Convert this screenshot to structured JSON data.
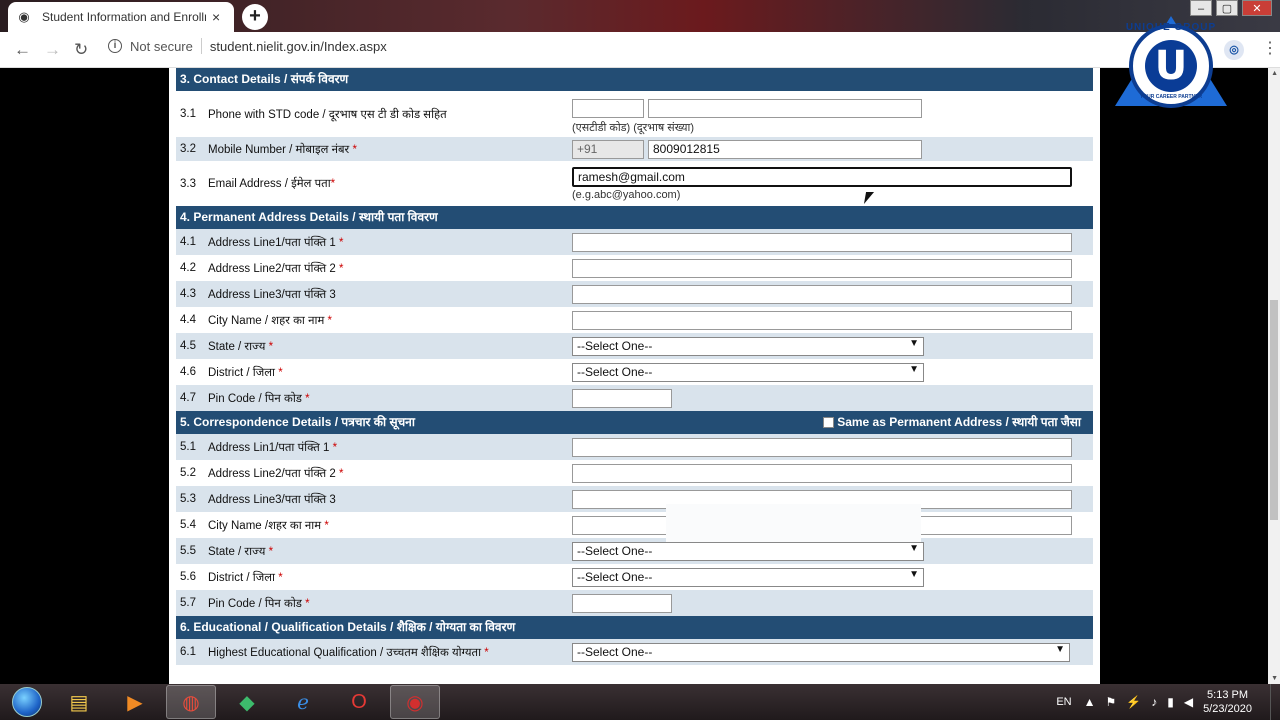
{
  "browser": {
    "tab_title": "Student Information and Enrollm",
    "security_label": "Not secure",
    "url": "student.nielit.gov.in/Index.aspx",
    "new_tab_symbol": "+",
    "tab_close_symbol": "×",
    "window_controls": [
      "‒",
      "▢",
      "✕"
    ]
  },
  "logo": {
    "top_text": "UNIQUE GROUP",
    "letter": "U",
    "bottom_text": "YOUR CAREER PARTNER"
  },
  "form": {
    "sections": {
      "contact": "3. Contact Details / संपर्क विवरण",
      "permanent": "4. Permanent Address Details / स्थायी पता विवरण",
      "correspondence": "5. Correspondence Details / पत्रचार की सूचना",
      "same_as_label": "Same as Permanent Address / स्थायी पता जैसा",
      "education": "6. Educational / Qualification Details / शैक्षिक / योग्यता का विवरण"
    },
    "contact": {
      "phone": {
        "num": "3.1",
        "label": "Phone with STD code / दूरभाष एस टी डी कोड सहित",
        "hint": "(एसटीडी कोड) (दूरभाष संख्या)"
      },
      "mobile": {
        "num": "3.2",
        "label": "Mobile Number / मोबाइल नंबर",
        "prefix": "+91",
        "value": "8009012815"
      },
      "email": {
        "num": "3.3",
        "label": "Email Address / ईमेल पता",
        "value": "ramesh@gmail.com",
        "hint": "(e.g.abc@yahoo.com)"
      }
    },
    "permanent": {
      "line1": {
        "num": "4.1",
        "label": "Address Line1/पता पंक्ति 1"
      },
      "line2": {
        "num": "4.2",
        "label": "Address Line2/पता पंक्ति 2"
      },
      "line3": {
        "num": "4.3",
        "label": "Address Line3/पता पंक्ति 3"
      },
      "city": {
        "num": "4.4",
        "label": "City Name / शहर का नाम"
      },
      "state": {
        "num": "4.5",
        "label": "State / राज्य",
        "selected": "--Select One--"
      },
      "district": {
        "num": "4.6",
        "label": "District / जिला",
        "selected": "--Select One--"
      },
      "pin": {
        "num": "4.7",
        "label": "Pin Code / पिन कोड"
      }
    },
    "correspondence": {
      "line1": {
        "num": "5.1",
        "label": "Address Lin1/पता पंक्ति 1"
      },
      "line2": {
        "num": "5.2",
        "label": "Address Line2/पता पंक्ति 2"
      },
      "line3": {
        "num": "5.3",
        "label": "Address Line3/पता पंक्ति 3"
      },
      "city": {
        "num": "5.4",
        "label": "City Name /शहर का नाम"
      },
      "state": {
        "num": "5.5",
        "label": "State / राज्य",
        "selected": "--Select One--"
      },
      "district": {
        "num": "5.6",
        "label": "District / जिला",
        "selected": "--Select One--"
      },
      "pin": {
        "num": "5.7",
        "label": "Pin Code / पिन कोड"
      }
    },
    "education": {
      "highest": {
        "num": "6.1",
        "label": "Highest Educational Qualification / उच्चतम शैक्षिक योग्यता",
        "selected": "--Select One--"
      }
    },
    "required_mark": "*"
  },
  "taskbar": {
    "language": "EN",
    "time": "5:13 PM",
    "date": "5/23/2020",
    "apps": [
      "file-explorer",
      "media-player",
      "chrome",
      "app-green",
      "internet-explorer",
      "opera",
      "recorder"
    ]
  },
  "colors": {
    "section_header": "#234d74",
    "row_alt": "#d9e3ec",
    "required": "#cc0000"
  }
}
